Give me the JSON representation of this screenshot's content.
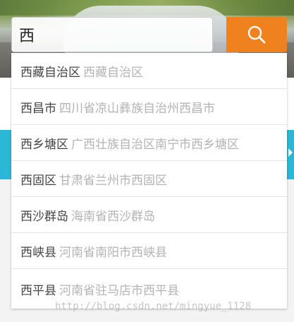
{
  "search": {
    "value": "西",
    "button_icon": "search-icon",
    "button_color": "#f0811f"
  },
  "suggestions": [
    {
      "name": "西藏自治区",
      "full": "西藏自治区"
    },
    {
      "name": "西昌市",
      "full": "四川省凉山彝族自治州西昌市"
    },
    {
      "name": "西乡塘区",
      "full": "广西壮族自治区南宁市西乡塘区"
    },
    {
      "name": "西固区",
      "full": "甘肃省兰州市西固区"
    },
    {
      "name": "西沙群岛",
      "full": "海南省西沙群岛"
    },
    {
      "name": "西峡县",
      "full": "河南省南阳市西峡县"
    },
    {
      "name": "西平县",
      "full": "河南省驻马店市西平县"
    }
  ],
  "watermark": "http://blog.csdn.net/mingyue_1128",
  "colors": {
    "accent": "#f0811f",
    "band": "#2bb7d6",
    "name_text": "#444444",
    "full_text": "#b3b3b3"
  }
}
